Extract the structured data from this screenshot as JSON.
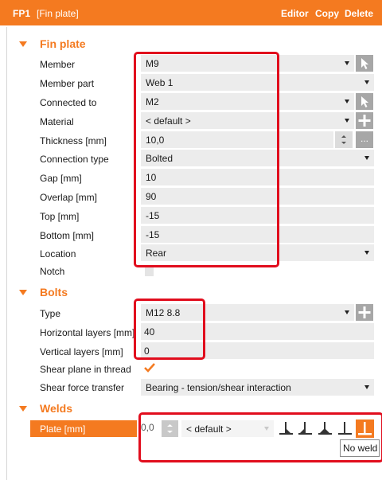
{
  "header": {
    "id": "FP1",
    "name": "[Fin plate]",
    "actions": {
      "editor": "Editor",
      "copy": "Copy",
      "delete": "Delete"
    }
  },
  "sections": {
    "fin_plate": "Fin plate",
    "bolts": "Bolts",
    "welds": "Welds"
  },
  "fin_plate": {
    "member": {
      "label": "Member",
      "value": "M9"
    },
    "member_part": {
      "label": "Member part",
      "value": "Web 1"
    },
    "connected_to": {
      "label": "Connected to",
      "value": "M2"
    },
    "material": {
      "label": "Material",
      "value": "< default >"
    },
    "thickness": {
      "label": "Thickness [mm]",
      "value": "10,0",
      "more": "..."
    },
    "connection_type": {
      "label": "Connection type",
      "value": "Bolted"
    },
    "gap": {
      "label": "Gap [mm]",
      "value": "10"
    },
    "overlap": {
      "label": "Overlap [mm]",
      "value": "90"
    },
    "top": {
      "label": "Top [mm]",
      "value": "-15"
    },
    "bottom": {
      "label": "Bottom [mm]",
      "value": "-15"
    },
    "location": {
      "label": "Location",
      "value": "Rear"
    },
    "notch": {
      "label": "Notch",
      "checked": false
    }
  },
  "bolts": {
    "type": {
      "label": "Type",
      "value": "M12 8.8"
    },
    "horizontal_layers": {
      "label": "Horizontal layers [mm]",
      "value": "40"
    },
    "vertical_layers": {
      "label": "Vertical layers [mm]",
      "value": "0"
    },
    "shear_plane_in_thread": {
      "label": "Shear plane in thread",
      "checked": true
    },
    "shear_force_transfer": {
      "label": "Shear force transfer",
      "value": "Bearing - tension/shear interaction"
    }
  },
  "welds": {
    "plate": {
      "label": "Plate [mm]",
      "thickness": "0,0",
      "material": "< default >",
      "weld_types": [
        "fillet-weld-icon",
        "fillet-weld-icon",
        "double-fillet-weld-icon",
        "fillet-weld-icon",
        "no-weld-icon"
      ],
      "selected_weld": "No weld",
      "tooltip": "No weld"
    }
  },
  "colors": {
    "accent": "#f47a20",
    "highlight": "#e10d1d",
    "field": "#ececec",
    "button": "#a7a7a7"
  }
}
